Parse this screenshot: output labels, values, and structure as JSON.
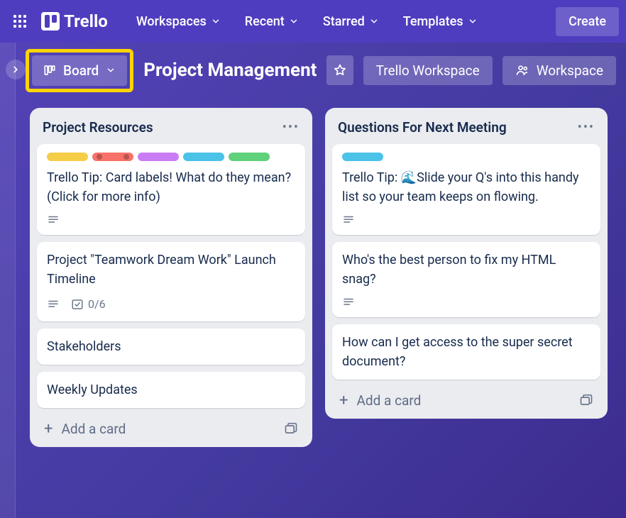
{
  "topbar": {
    "logo_text": "Trello",
    "nav": {
      "workspaces": "Workspaces",
      "recent": "Recent",
      "starred": "Starred",
      "templates": "Templates"
    },
    "create": "Create"
  },
  "boardbar": {
    "view_label": "Board",
    "title": "Project Management",
    "workspace": "Trello Workspace",
    "visibility": "Workspace"
  },
  "lists": [
    {
      "title": "Project Resources",
      "add_label": "Add a card",
      "cards": [
        {
          "text": "Trello Tip: Card labels! What do they mean? (Click for more info)",
          "labels": [
            "y",
            "r",
            "p",
            "b",
            "g"
          ],
          "desc": true
        },
        {
          "text": "Project \"Teamwork Dream Work\" Launch Timeline",
          "desc": true,
          "checklist": "0/6"
        },
        {
          "text": "Stakeholders"
        },
        {
          "text": "Weekly Updates"
        }
      ]
    },
    {
      "title": "Questions For Next Meeting",
      "add_label": "Add a card",
      "cards": [
        {
          "text": "Trello Tip: 🌊Slide your Q's into this handy list so your team keeps on flowing.",
          "labels": [
            "b"
          ],
          "desc": true
        },
        {
          "text": "Who's the best person to fix my HTML snag?",
          "desc": true
        },
        {
          "text": "How can I get access to the super secret document?"
        }
      ]
    }
  ]
}
